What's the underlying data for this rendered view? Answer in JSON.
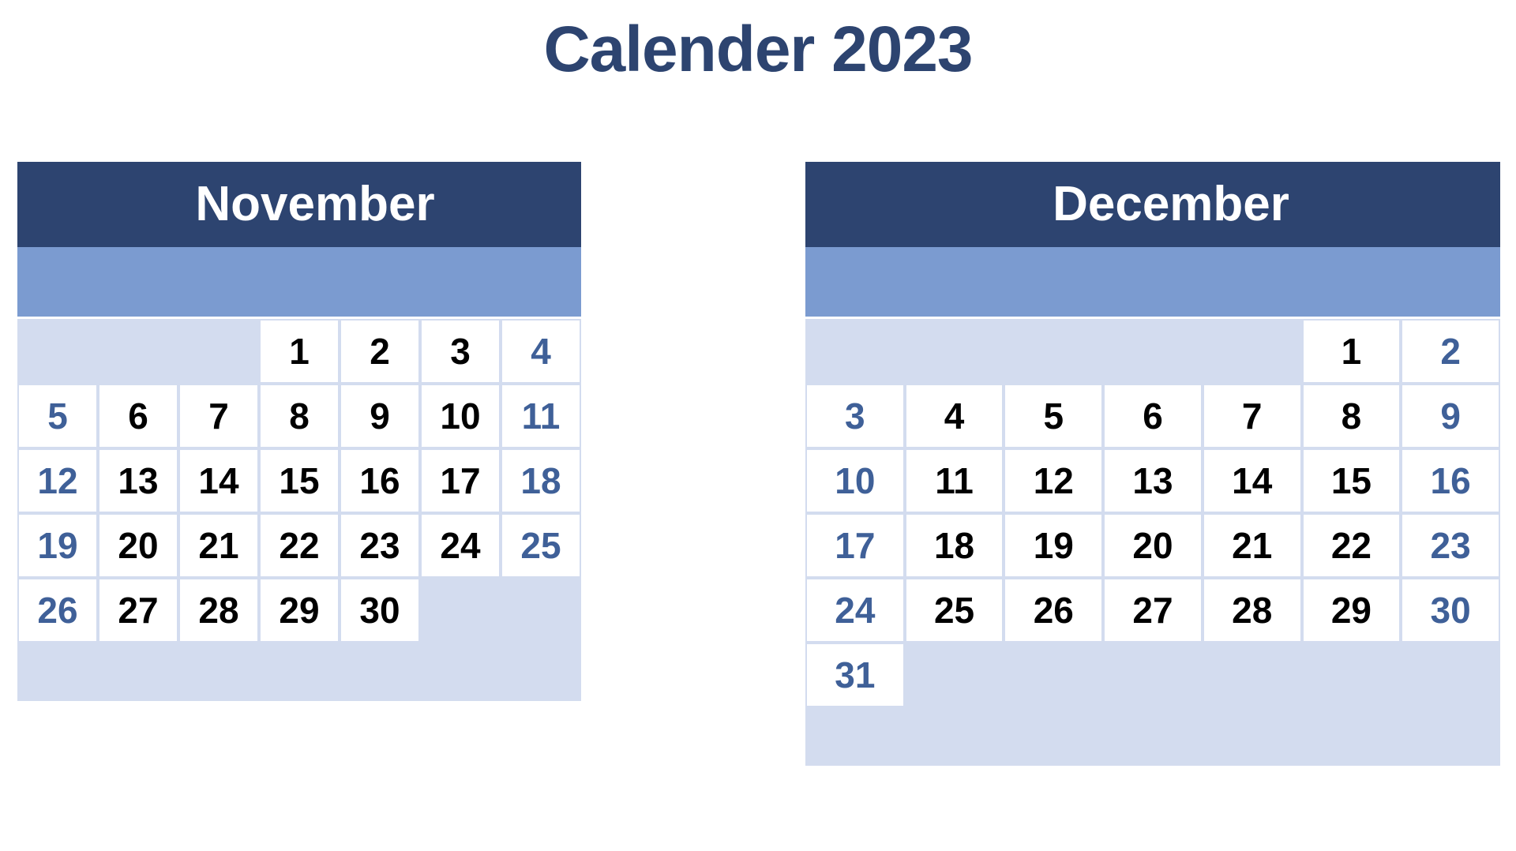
{
  "title": "Calender 2023",
  "colors": {
    "title_text": "#2d4470",
    "header_bg": "#2d4470",
    "header_text": "#ffffff",
    "weekday_band_bg": "#7b9bd0",
    "empty_cell_bg": "#d3dcef",
    "date_cell_bg": "#ffffff",
    "weekday_date_text": "#000000",
    "weekend_date_text": "#3f6098",
    "grid_line": "#d3dcef",
    "page_bg": "#ffffff"
  },
  "weekday_labels": [
    "",
    "",
    "",
    "",
    "",
    "",
    ""
  ],
  "months": [
    {
      "name": "November",
      "year": "2023",
      "start_weekday_index": 3,
      "days_in_month": 30,
      "weeks": [
        [
          {
            "day": "",
            "type": "empty"
          },
          {
            "day": "",
            "type": "empty"
          },
          {
            "day": "",
            "type": "empty"
          },
          {
            "day": "1",
            "type": "weekday"
          },
          {
            "day": "2",
            "type": "weekday"
          },
          {
            "day": "3",
            "type": "weekday"
          },
          {
            "day": "4",
            "type": "weekend"
          }
        ],
        [
          {
            "day": "5",
            "type": "weekend"
          },
          {
            "day": "6",
            "type": "weekday"
          },
          {
            "day": "7",
            "type": "weekday"
          },
          {
            "day": "8",
            "type": "weekday"
          },
          {
            "day": "9",
            "type": "weekday"
          },
          {
            "day": "10",
            "type": "weekday"
          },
          {
            "day": "11",
            "type": "weekend"
          }
        ],
        [
          {
            "day": "12",
            "type": "weekend"
          },
          {
            "day": "13",
            "type": "weekday"
          },
          {
            "day": "14",
            "type": "weekday"
          },
          {
            "day": "15",
            "type": "weekday"
          },
          {
            "day": "16",
            "type": "weekday"
          },
          {
            "day": "17",
            "type": "weekday"
          },
          {
            "day": "18",
            "type": "weekend"
          }
        ],
        [
          {
            "day": "19",
            "type": "weekend"
          },
          {
            "day": "20",
            "type": "weekday"
          },
          {
            "day": "21",
            "type": "weekday"
          },
          {
            "day": "22",
            "type": "weekday"
          },
          {
            "day": "23",
            "type": "weekday"
          },
          {
            "day": "24",
            "type": "weekday"
          },
          {
            "day": "25",
            "type": "weekend"
          }
        ],
        [
          {
            "day": "26",
            "type": "weekend"
          },
          {
            "day": "27",
            "type": "weekday"
          },
          {
            "day": "28",
            "type": "weekday"
          },
          {
            "day": "29",
            "type": "weekday"
          },
          {
            "day": "30",
            "type": "weekday"
          },
          {
            "day": "",
            "type": "empty"
          },
          {
            "day": "",
            "type": "empty"
          }
        ]
      ]
    },
    {
      "name": "December",
      "year": "2023",
      "start_weekday_index": 5,
      "days_in_month": 31,
      "weeks": [
        [
          {
            "day": "",
            "type": "empty"
          },
          {
            "day": "",
            "type": "empty"
          },
          {
            "day": "",
            "type": "empty"
          },
          {
            "day": "",
            "type": "empty"
          },
          {
            "day": "",
            "type": "empty"
          },
          {
            "day": "1",
            "type": "weekday"
          },
          {
            "day": "2",
            "type": "weekend"
          }
        ],
        [
          {
            "day": "3",
            "type": "weekend"
          },
          {
            "day": "4",
            "type": "weekday"
          },
          {
            "day": "5",
            "type": "weekday"
          },
          {
            "day": "6",
            "type": "weekday"
          },
          {
            "day": "7",
            "type": "weekday"
          },
          {
            "day": "8",
            "type": "weekday"
          },
          {
            "day": "9",
            "type": "weekend"
          }
        ],
        [
          {
            "day": "10",
            "type": "weekend"
          },
          {
            "day": "11",
            "type": "weekday"
          },
          {
            "day": "12",
            "type": "weekday"
          },
          {
            "day": "13",
            "type": "weekday"
          },
          {
            "day": "14",
            "type": "weekday"
          },
          {
            "day": "15",
            "type": "weekday"
          },
          {
            "day": "16",
            "type": "weekend"
          }
        ],
        [
          {
            "day": "17",
            "type": "weekend"
          },
          {
            "day": "18",
            "type": "weekday"
          },
          {
            "day": "19",
            "type": "weekday"
          },
          {
            "day": "20",
            "type": "weekday"
          },
          {
            "day": "21",
            "type": "weekday"
          },
          {
            "day": "22",
            "type": "weekday"
          },
          {
            "day": "23",
            "type": "weekend"
          }
        ],
        [
          {
            "day": "24",
            "type": "weekend"
          },
          {
            "day": "25",
            "type": "weekday"
          },
          {
            "day": "26",
            "type": "weekday"
          },
          {
            "day": "27",
            "type": "weekday"
          },
          {
            "day": "28",
            "type": "weekday"
          },
          {
            "day": "29",
            "type": "weekday"
          },
          {
            "day": "30",
            "type": "weekend"
          }
        ],
        [
          {
            "day": "31",
            "type": "weekend"
          },
          {
            "day": "",
            "type": "empty"
          },
          {
            "day": "",
            "type": "empty"
          },
          {
            "day": "",
            "type": "empty"
          },
          {
            "day": "",
            "type": "empty"
          },
          {
            "day": "",
            "type": "empty"
          },
          {
            "day": "",
            "type": "empty"
          }
        ]
      ]
    }
  ]
}
